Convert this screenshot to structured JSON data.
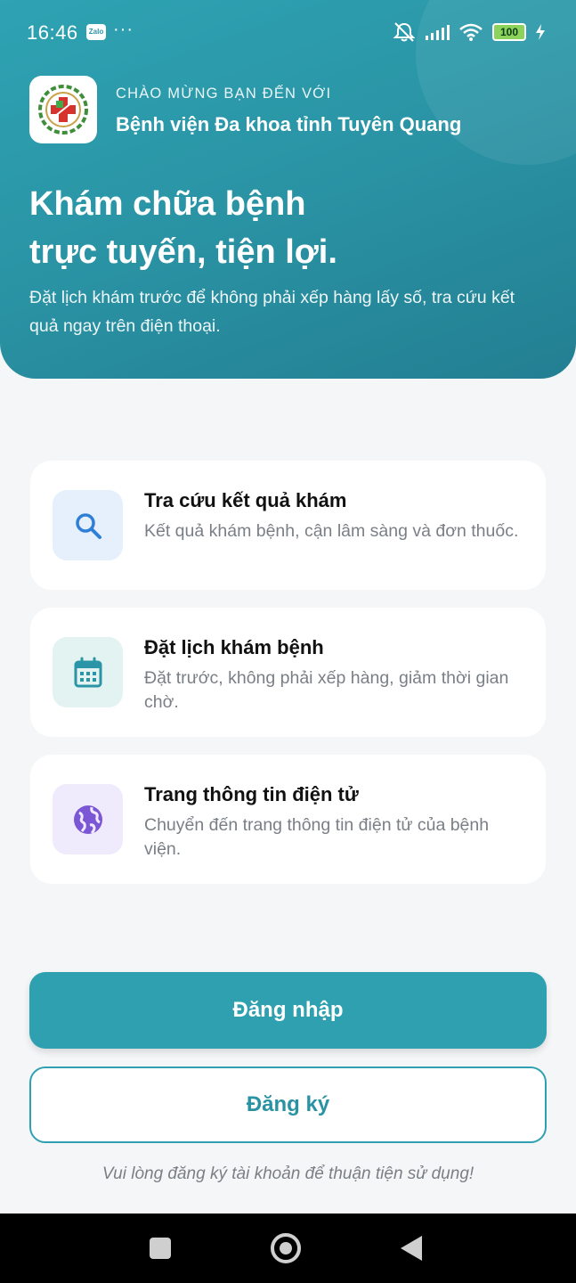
{
  "status": {
    "time": "16:46",
    "zalo": "Zalo",
    "dots": "···",
    "battery": "100"
  },
  "header": {
    "welcome": "CHÀO MỪNG BẠN ĐẾN VỚI",
    "hospital_name": "Bệnh viện Đa khoa tỉnh Tuyên Quang",
    "title_line1": "Khám chữa bệnh",
    "title_line2": "trực tuyến, tiện lợi.",
    "subtitle": "Đặt lịch khám trước để không phải xếp hàng lấy số, tra cứu kết quả ngay trên điện thoại."
  },
  "cards": [
    {
      "title": "Tra cứu kết quả khám",
      "desc": "Kết quả khám bệnh, cận lâm sàng và đơn thuốc.",
      "icon": "search-icon",
      "icon_bg": "#e6f0fc",
      "icon_color": "#2f7fd6"
    },
    {
      "title": "Đặt lịch khám bệnh",
      "desc": "Đặt trước, không phải xếp hàng, giảm thời gian chờ.",
      "icon": "calendar-icon",
      "icon_bg": "#e3f3f2",
      "icon_color": "#2a95a6"
    },
    {
      "title": "Trang thông tin điện tử",
      "desc": "Chuyển đến trang thông tin điện tử của bệnh viện.",
      "icon": "globe-icon",
      "icon_bg": "#efeafc",
      "icon_color": "#7b57d6"
    }
  ],
  "actions": {
    "login": "Đăng nhập",
    "register": "Đăng ký",
    "hint": "Vui lòng đăng ký tài khoản để thuận tiện sử dụng!"
  },
  "colors": {
    "primary": "#2fa0b0",
    "background": "#f4f6f8"
  }
}
